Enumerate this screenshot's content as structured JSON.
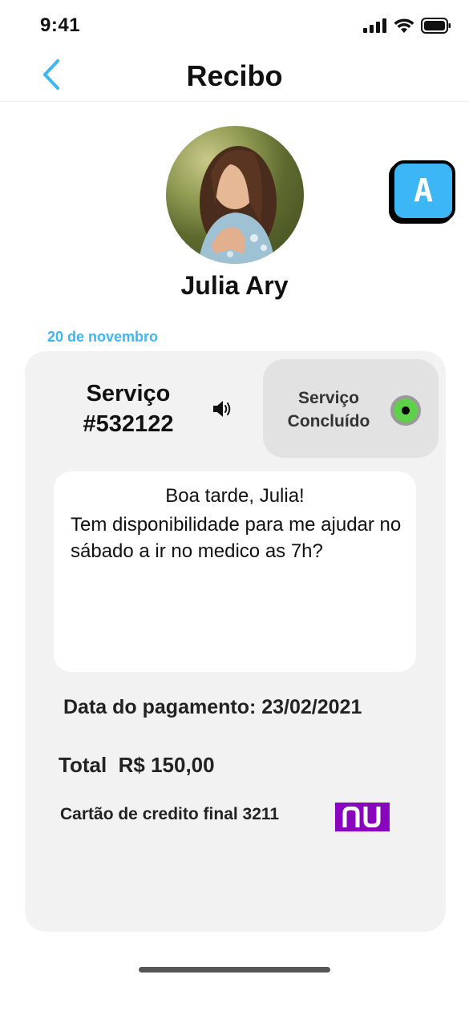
{
  "status_bar": {
    "time": "9:41",
    "icons": [
      "signal-icon",
      "wifi-icon",
      "battery-icon"
    ]
  },
  "header": {
    "title": "Recibo",
    "back_icon": "chevron-left-icon"
  },
  "profile": {
    "name": "Julia Ary",
    "badge_letter": "A"
  },
  "receipt": {
    "date": "20 de novembro",
    "service_label": "Serviço",
    "service_number": "#532122",
    "speaker_icon": "speaker-icon",
    "status_line1": "Serviço",
    "status_line2": "Concluído",
    "message_greeting": "Boa tarde, Julia!",
    "message_body": "Tem disponibilidade para me ajudar no sábado a ir no medico as 7h?",
    "payment_date": "Data do pagamento: 23/02/2021",
    "total": "Total  R$ 150,00",
    "card_info": "Cartão de credito final 3211",
    "bank_logo_text": "nu"
  },
  "colors": {
    "accent": "#3cb6f5",
    "card_bg": "#f2f2f2",
    "status_bg": "#e2e2e2",
    "status_dot": "#5fd04a",
    "nubank_purple": "#8a05be"
  }
}
